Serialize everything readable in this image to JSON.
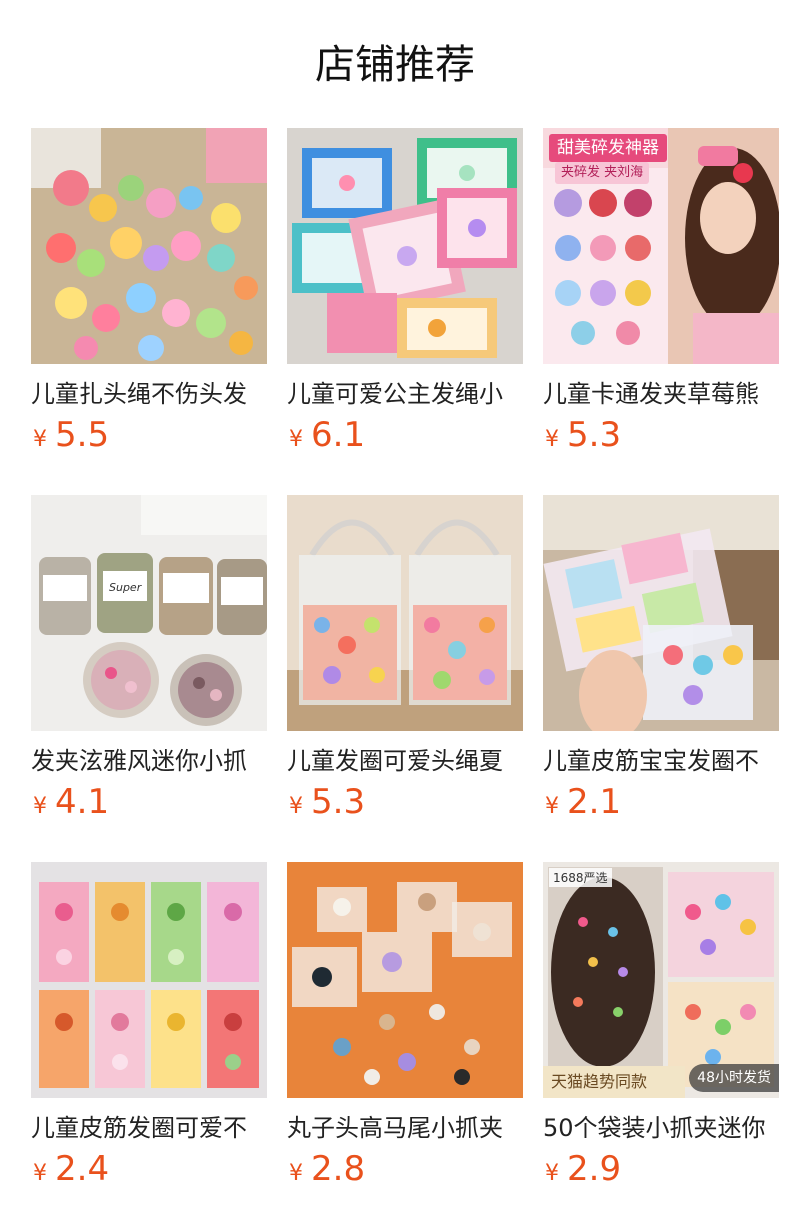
{
  "page": {
    "title": "店铺推荐"
  },
  "products": [
    {
      "name": "儿童扎头绳不伤头发",
      "currency": "¥",
      "price": "5.5",
      "image_icon": "hair-ties-pile-image"
    },
    {
      "name": "儿童可爱公主发绳小",
      "currency": "¥",
      "price": "6.1",
      "image_icon": "boxed-hair-clips-image"
    },
    {
      "name": "儿童卡通发夹草莓熊",
      "currency": "¥",
      "price": "5.3",
      "image_icon": "cartoon-clips-model-image",
      "image_text": {
        "caption": "甜美碎发神器",
        "sub": "夹碎发 夹刘海"
      }
    },
    {
      "name": "发夹泫雅风迷你小抓",
      "currency": "¥",
      "price": "4.1",
      "image_icon": "mini-claw-jars-image",
      "image_text": {
        "jar_label": "Super"
      }
    },
    {
      "name": "儿童发圈可爱头绳夏",
      "currency": "¥",
      "price": "5.3",
      "image_icon": "clear-tote-bags-image"
    },
    {
      "name": "儿童皮筋宝宝发圈不",
      "currency": "¥",
      "price": "2.1",
      "image_icon": "hand-holding-box-image"
    },
    {
      "name": "儿童皮筋发圈可爱不",
      "currency": "¥",
      "price": "2.4",
      "image_icon": "compartment-boxes-image"
    },
    {
      "name": "丸子头高马尾小抓夹",
      "currency": "¥",
      "price": "2.8",
      "image_icon": "claw-clips-orange-image"
    },
    {
      "name": "50个袋装小抓夹迷你",
      "currency": "¥",
      "price": "2.9",
      "image_icon": "girl-hair-clips-image",
      "image_text": {
        "top": "1688严选",
        "bottom_left": "天猫趋势同款",
        "bottom_right": "48小时发货"
      }
    }
  ]
}
